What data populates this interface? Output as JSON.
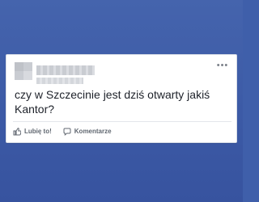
{
  "post": {
    "text": "czy w Szczecinie jest dziś otwarty jakiś Kantor?",
    "more_icon": "ellipsis-icon"
  },
  "actions": {
    "like_label": "Lubię to!",
    "like_icon": "like-icon",
    "comment_label": "Komentarze",
    "comment_icon": "comment-icon"
  },
  "colors": {
    "background": "#3f5faa",
    "card": "#ffffff",
    "text": "#1d2129",
    "muted": "#606770"
  }
}
